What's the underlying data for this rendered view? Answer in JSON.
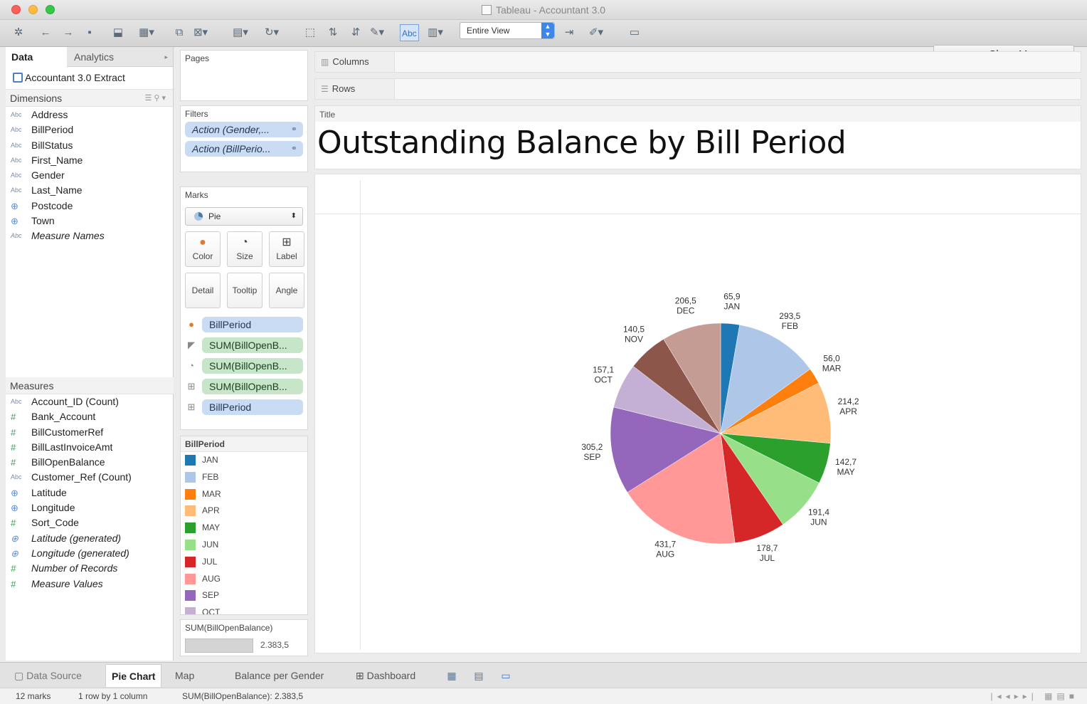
{
  "window": {
    "title": "Tableau - Accountant 3.0"
  },
  "toolbar": {
    "abc_label": "Abc",
    "fit_value": "Entire View",
    "show_me_label": "Show Me"
  },
  "data_pane": {
    "tab_data": "Data",
    "tab_analytics": "Analytics",
    "datasource": "Accountant 3.0 Extract",
    "dimensions_header": "Dimensions",
    "dimensions": [
      {
        "type": "Abc",
        "name": "Address"
      },
      {
        "type": "Abc",
        "name": "BillPeriod"
      },
      {
        "type": "Abc",
        "name": "BillStatus"
      },
      {
        "type": "Abc",
        "name": "First_Name"
      },
      {
        "type": "Abc",
        "name": "Gender"
      },
      {
        "type": "Abc",
        "name": "Last_Name"
      },
      {
        "type": "geo",
        "name": "Postcode"
      },
      {
        "type": "geo",
        "name": "Town"
      },
      {
        "type": "Abc",
        "name": "Measure Names"
      }
    ],
    "measures_header": "Measures",
    "measures": [
      {
        "type": "Abc",
        "name": "Account_ID (Count)"
      },
      {
        "type": "#",
        "name": "Bank_Account"
      },
      {
        "type": "#",
        "name": "BillCustomerRef"
      },
      {
        "type": "#",
        "name": "BillLastInvoiceAmt"
      },
      {
        "type": "#",
        "name": "BillOpenBalance"
      },
      {
        "type": "Abc",
        "name": "Customer_Ref (Count)"
      },
      {
        "type": "geo",
        "name": "Latitude"
      },
      {
        "type": "geo",
        "name": "Longitude"
      },
      {
        "type": "#",
        "name": "Sort_Code"
      },
      {
        "type": "geo",
        "name": "Latitude (generated)"
      },
      {
        "type": "geo",
        "name": "Longitude (generated)"
      },
      {
        "type": "#",
        "name": "Number of Records"
      },
      {
        "type": "#",
        "name": "Measure Values"
      }
    ]
  },
  "shelves": {
    "pages_label": "Pages",
    "filters_label": "Filters",
    "filters": [
      "Action (Gender,...",
      "Action (BillPerio..."
    ],
    "marks_label": "Marks",
    "mark_type": "Pie",
    "buttons": {
      "color": "Color",
      "size": "Size",
      "label": "Label",
      "detail": "Detail",
      "tooltip": "Tooltip",
      "angle": "Angle"
    },
    "mark_fields": [
      {
        "kind": "color",
        "name": "BillPeriod",
        "pill": "blue"
      },
      {
        "kind": "angle",
        "name": "SUM(BillOpenB...",
        "pill": "green"
      },
      {
        "kind": "size",
        "name": "SUM(BillOpenB...",
        "pill": "green"
      },
      {
        "kind": "label",
        "name": "SUM(BillOpenB...",
        "pill": "green"
      },
      {
        "kind": "label",
        "name": "BillPeriod",
        "pill": "blue"
      }
    ],
    "legend_title": "BillPeriod",
    "legend": [
      {
        "label": "JAN",
        "color": "#1f77b4"
      },
      {
        "label": "FEB",
        "color": "#aec7e8"
      },
      {
        "label": "MAR",
        "color": "#ff7f0e"
      },
      {
        "label": "APR",
        "color": "#ffbb78"
      },
      {
        "label": "MAY",
        "color": "#2ca02c"
      },
      {
        "label": "JUN",
        "color": "#98df8a"
      },
      {
        "label": "JUL",
        "color": "#d62728"
      },
      {
        "label": "AUG",
        "color": "#ff9896"
      },
      {
        "label": "SEP",
        "color": "#9467bd"
      },
      {
        "label": "OCT",
        "color": "#c5b0d5"
      }
    ],
    "size_legend_title": "SUM(BillOpenBalance)",
    "size_legend_value": "2.383,5"
  },
  "sheet": {
    "columns_label": "Columns",
    "rows_label": "Rows",
    "title_card_label": "Title",
    "title": "Outstanding Balance by Bill Period"
  },
  "chart_data": {
    "type": "pie",
    "title": "Outstanding Balance by Bill Period",
    "categories": [
      "JAN",
      "FEB",
      "MAR",
      "APR",
      "MAY",
      "JUN",
      "JUL",
      "AUG",
      "SEP",
      "OCT",
      "NOV",
      "DEC"
    ],
    "values": [
      65.9,
      293.5,
      56.0,
      214.2,
      142.7,
      191.4,
      178.7,
      431.7,
      305.2,
      157.1,
      140.5,
      206.5
    ],
    "value_labels": [
      "65,9",
      "293,5",
      "56,0",
      "214,2",
      "142,7",
      "191,4",
      "178,7",
      "431,7",
      "305,2",
      "157,1",
      "140,5",
      "206,5"
    ],
    "colors": [
      "#1f77b4",
      "#aec7e8",
      "#ff7f0e",
      "#ffbb78",
      "#2ca02c",
      "#98df8a",
      "#d62728",
      "#ff9896",
      "#9467bd",
      "#c5b0d5",
      "#8c564b",
      "#c49c94"
    ]
  },
  "sheet_tabs": {
    "data_source": "Data Source",
    "tabs": [
      "Pie Chart",
      "Map",
      "Balance per Gender",
      "Dashboard"
    ]
  },
  "status": {
    "marks": "12 marks",
    "dims": "1 row by 1 column",
    "sum": "SUM(BillOpenBalance): 2.383,5"
  }
}
